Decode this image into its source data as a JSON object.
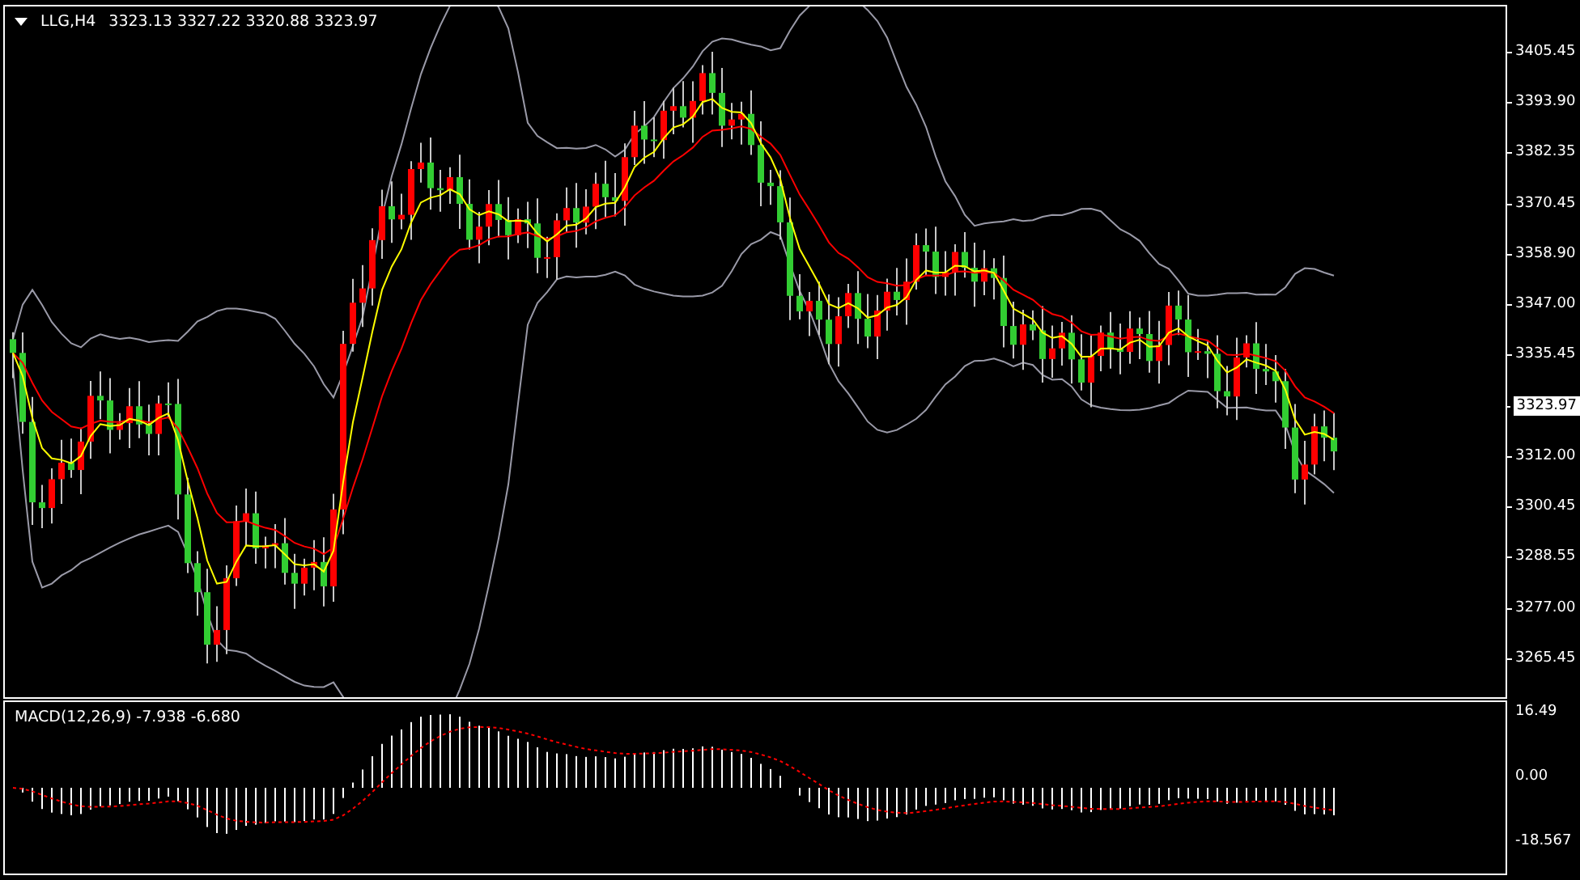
{
  "chart_header": {
    "symbol": "LLG,H4",
    "prices": "3323.13 3327.22 3320.88 3323.97"
  },
  "price_axis": [
    {
      "text": "3405.45",
      "kind": "tick"
    },
    {
      "text": "3393.90",
      "kind": "tick"
    },
    {
      "text": "3382.35",
      "kind": "tick"
    },
    {
      "text": "3370.45",
      "kind": "tick"
    },
    {
      "text": "3358.90",
      "kind": "tick"
    },
    {
      "text": "3347.00",
      "kind": "tick"
    },
    {
      "text": "3335.45",
      "kind": "tick"
    },
    {
      "text": "3323.97",
      "kind": "current"
    },
    {
      "text": "3312.00",
      "kind": "tick"
    },
    {
      "text": "3300.45",
      "kind": "tick"
    },
    {
      "text": "3288.55",
      "kind": "tick"
    },
    {
      "text": "3277.00",
      "kind": "tick"
    },
    {
      "text": "3265.45",
      "kind": "tick"
    }
  ],
  "macd_panel": {
    "label": "MACD(12,26,9) -7.938 -6.680",
    "axis": [
      "16.49",
      "0.00",
      "-18.567"
    ]
  }
}
